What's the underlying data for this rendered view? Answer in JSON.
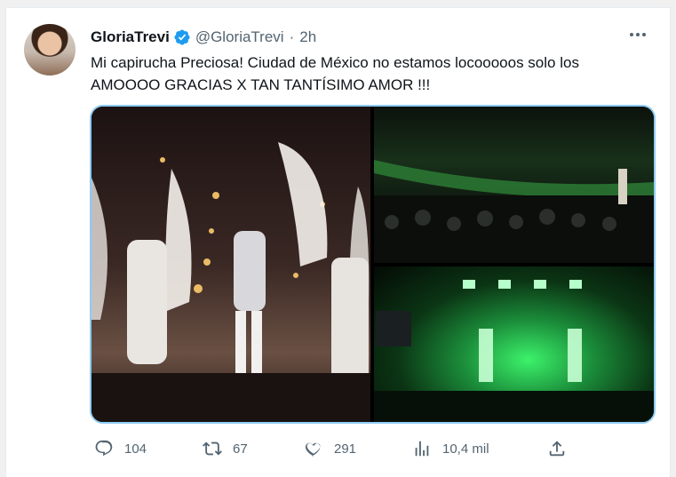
{
  "tweet": {
    "display_name": "GloriaTrevi",
    "handle": "@GloriaTrevi",
    "separator": "·",
    "time": "2h",
    "text_line1": "Mi capirucha Preciosa! Ciudad de México no estamos locooooos solo los",
    "text_line2": "AMOOOO GRACIAS X TAN TANTÍSIMO AMOR !!!"
  },
  "actions": {
    "replies": "104",
    "retweets": "67",
    "likes": "291",
    "views": "10,4 mil"
  },
  "colors": {
    "verified": "#1d9bf0",
    "secondary_text": "#536471",
    "media_border": "#8ecbf3"
  },
  "icons": [
    "verified-badge-icon",
    "more-icon",
    "reply-icon",
    "retweet-icon",
    "like-icon",
    "views-icon",
    "share-icon"
  ]
}
